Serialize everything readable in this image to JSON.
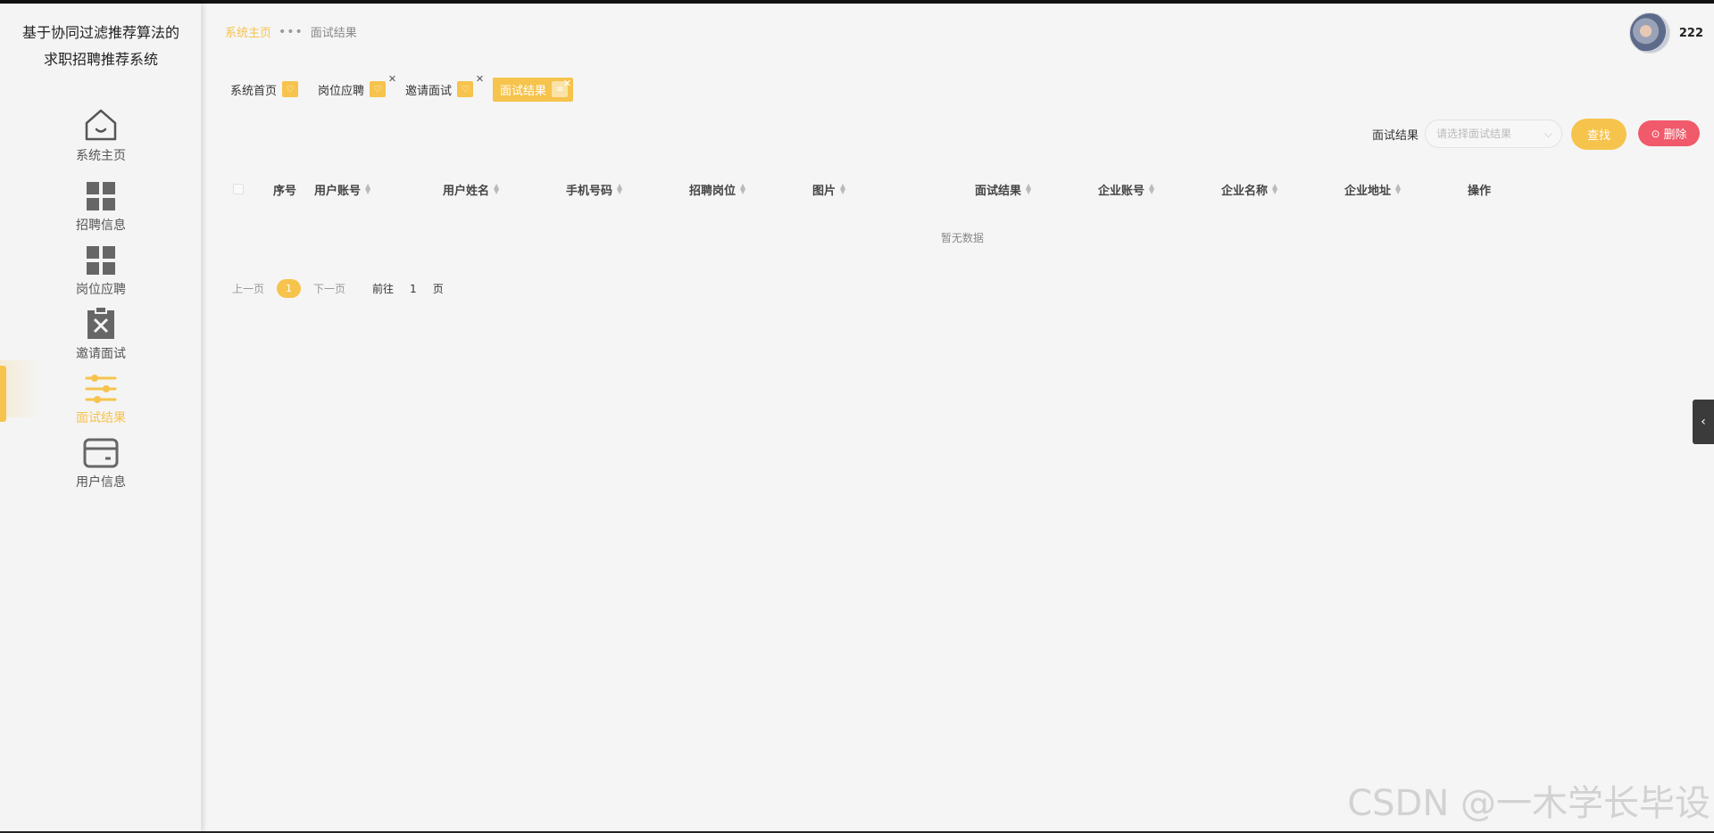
{
  "app": {
    "title_line1": "基于协同过滤推荐算法的",
    "title_line2": "求职招聘推荐系统"
  },
  "sidebar": {
    "items": [
      {
        "label": "系统主页",
        "icon": "home-icon"
      },
      {
        "label": "招聘信息",
        "icon": "grid-icon"
      },
      {
        "label": "岗位应聘",
        "icon": "grid-icon"
      },
      {
        "label": "邀请面试",
        "icon": "clipboard-x-icon"
      },
      {
        "label": "面试结果",
        "icon": "sliders-icon",
        "active": true
      },
      {
        "label": "用户信息",
        "icon": "card-icon"
      }
    ]
  },
  "breadcrumb": {
    "home": "系统主页",
    "separator": "•••",
    "current": "面试结果"
  },
  "user": {
    "name": "222"
  },
  "tags": [
    {
      "label": "系统首页"
    },
    {
      "label": "岗位应聘"
    },
    {
      "label": "邀请面试"
    },
    {
      "label": "面试结果"
    }
  ],
  "search": {
    "label": "面试结果",
    "placeholder": "请选择面试结果",
    "search_button": "查找",
    "delete_button": "删除"
  },
  "table": {
    "columns": [
      "序号",
      "用户账号",
      "用户姓名",
      "手机号码",
      "招聘岗位",
      "图片",
      "面试结果",
      "企业账号",
      "企业名称",
      "企业地址",
      "操作"
    ],
    "empty_text": "暂无数据"
  },
  "pagination": {
    "prev": "上一页",
    "current": "1",
    "next": "下一页",
    "goto": "前往",
    "goto_value": "1",
    "unit": "页"
  },
  "watermark": "CSDN @一木学长毕设",
  "colors": {
    "accent": "#f6c34c",
    "danger": "#f05a6a"
  }
}
